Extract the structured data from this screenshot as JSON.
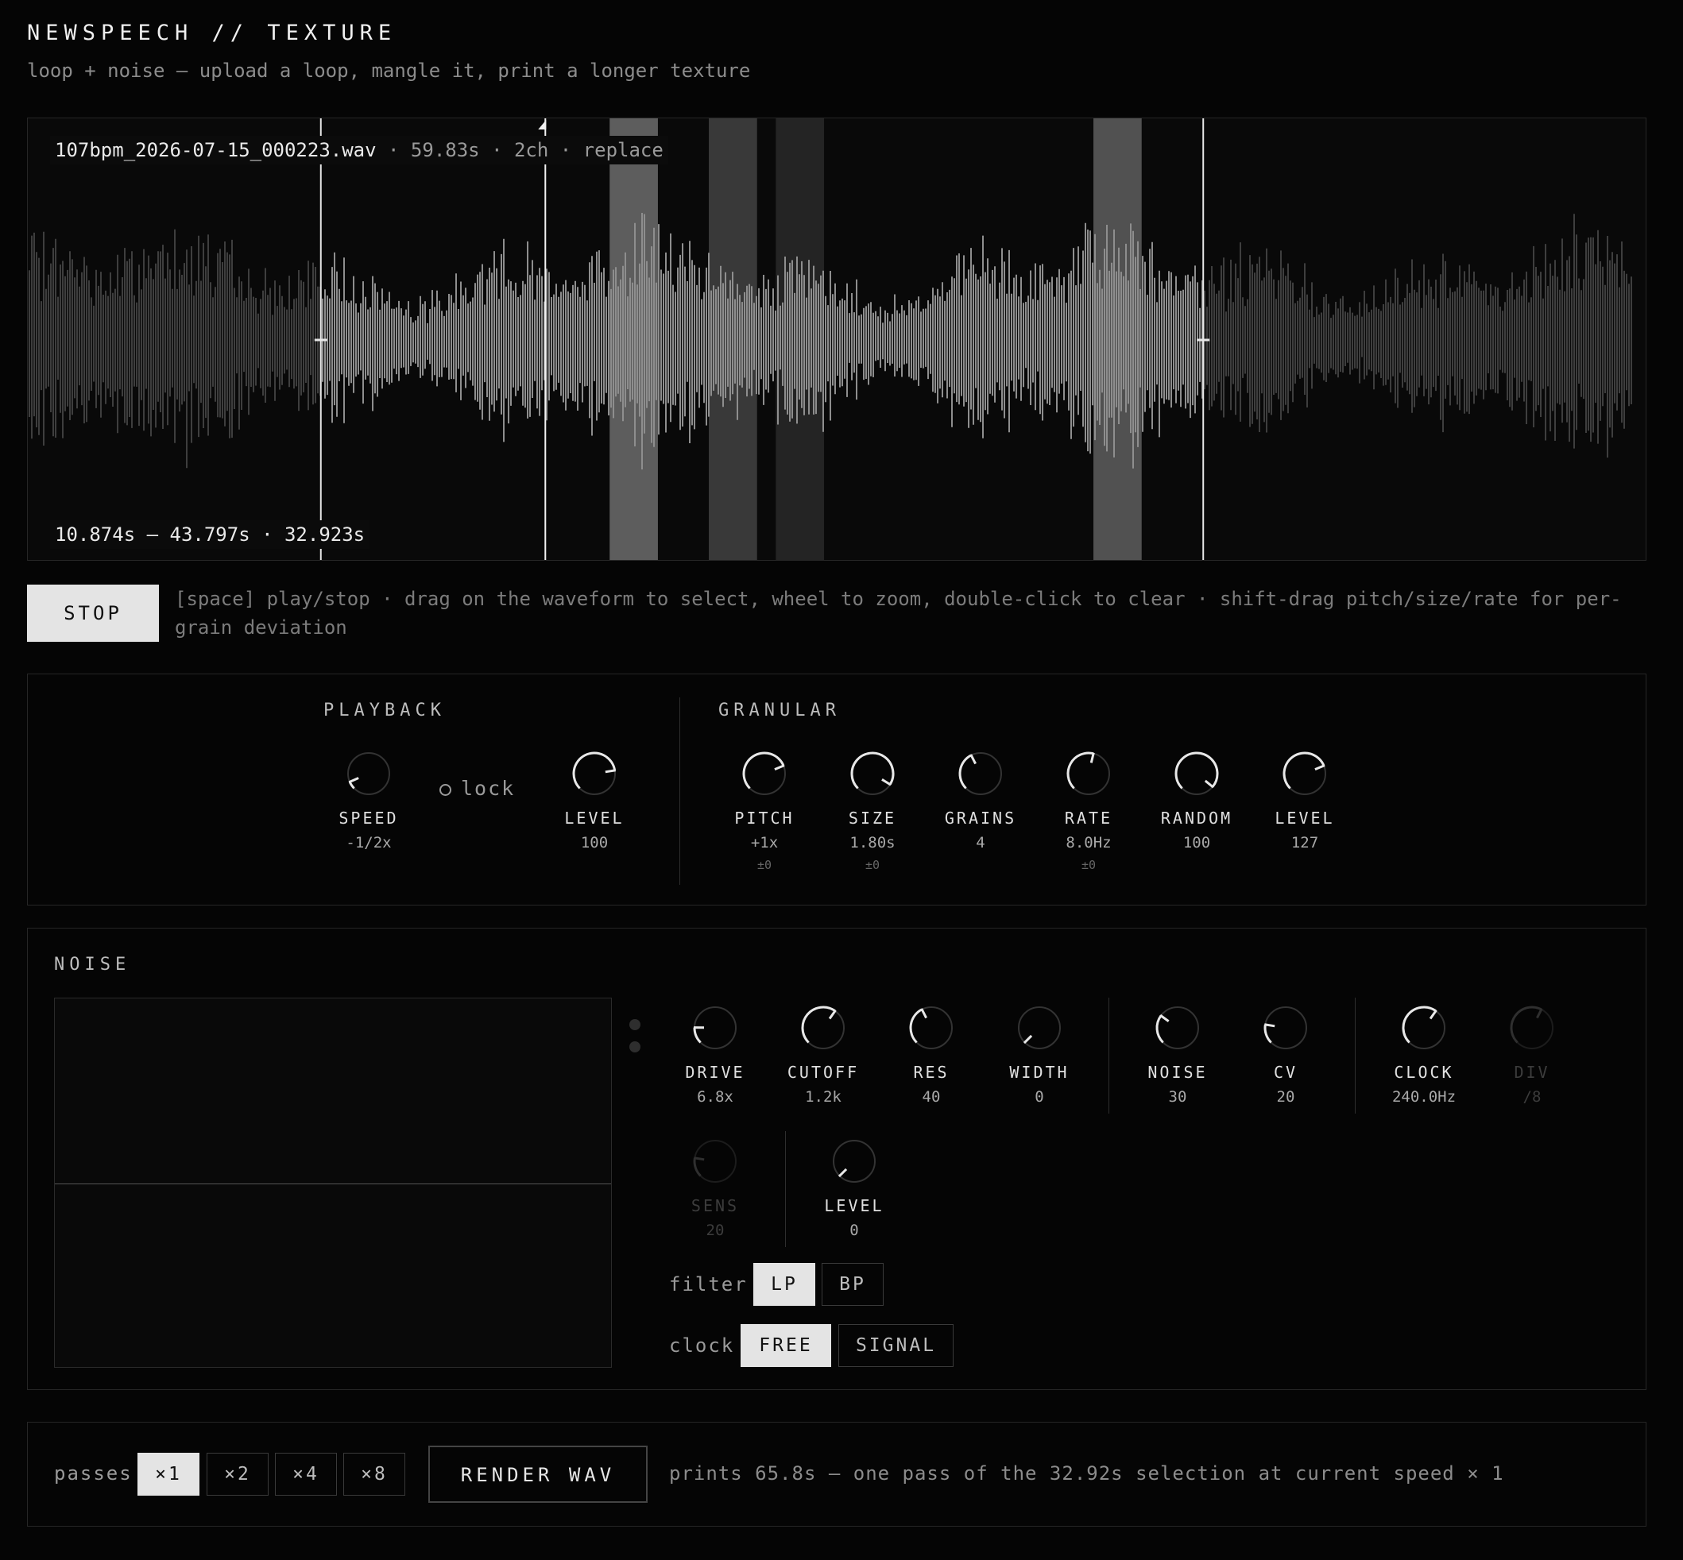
{
  "header": {
    "title": "NEWSPEECH // TEXTURE",
    "subtitle": "loop + noise — upload a loop, mangle it, print a longer texture"
  },
  "waveform": {
    "file_name": "107bpm_2026-07-15_000223.wav",
    "file_meta": "· 59.83s · 2ch ·",
    "replace_label": "replace",
    "selection_readout": "10.874s — 43.797s · 32.923s",
    "duration_s": 59.83,
    "selection_start_s": 10.874,
    "selection_end_s": 43.797,
    "playhead_s": 19.25,
    "grain_windows_s": [
      [
        21.65,
        23.45
      ],
      [
        25.35,
        27.15
      ],
      [
        27.85,
        29.65
      ],
      [
        39.7,
        41.5
      ]
    ]
  },
  "transport": {
    "stop_label": "STOP",
    "hint": "[space] play/stop  ·  drag on the waveform to select, wheel to zoom, double-click to clear  ·  shift-drag pitch/size/rate for per-grain deviation"
  },
  "playback": {
    "title": "PLAYBACK",
    "lock_label": "lock",
    "speed": {
      "label": "SPEED",
      "value": "-1/2x",
      "pos": 0.08
    },
    "level": {
      "label": "LEVEL",
      "value": "100",
      "pos": 0.8
    }
  },
  "granular": {
    "title": "GRANULAR",
    "knobs": [
      {
        "label": "PITCH",
        "value": "+1x",
        "dev": "±0",
        "pos": 0.75
      },
      {
        "label": "SIZE",
        "value": "1.80s",
        "dev": "±0",
        "pos": 0.95
      },
      {
        "label": "GRAINS",
        "value": "4",
        "dev": "",
        "pos": 0.4
      },
      {
        "label": "RATE",
        "value": "8.0Hz",
        "dev": "±0",
        "pos": 0.55
      },
      {
        "label": "RANDOM",
        "value": "100",
        "dev": "",
        "pos": 0.98
      },
      {
        "label": "LEVEL",
        "value": "127",
        "dev": "",
        "pos": 0.75
      }
    ]
  },
  "noise": {
    "title": "NOISE",
    "knobs": [
      {
        "label": "DRIVE",
        "value": "6.8x",
        "pos": 0.17,
        "disabled": false
      },
      {
        "label": "CUTOFF",
        "value": "1.2k",
        "pos": 0.63,
        "disabled": false
      },
      {
        "label": "RES",
        "value": "40",
        "pos": 0.4,
        "disabled": false
      },
      {
        "label": "WIDTH",
        "value": "0",
        "pos": 0.0,
        "disabled": false
      },
      {
        "label": "NOISE",
        "value": "30",
        "pos": 0.3,
        "disabled": false
      },
      {
        "label": "CV",
        "value": "20",
        "pos": 0.2,
        "disabled": false
      },
      {
        "label": "CLOCK",
        "value": "240.0Hz",
        "pos": 0.63,
        "disabled": false
      },
      {
        "label": "DIV",
        "value": "/8",
        "pos": 0.6,
        "disabled": true
      },
      {
        "label": "SENS",
        "value": "20",
        "pos": 0.2,
        "disabled": true
      },
      {
        "label": "LEVEL",
        "value": "0",
        "pos": 0.0,
        "disabled": false
      }
    ],
    "filter_label": "filter",
    "filter_options": [
      "LP",
      "BP"
    ],
    "filter_selected": "LP",
    "clock_label": "clock",
    "clock_options": [
      "FREE",
      "SIGNAL"
    ],
    "clock_selected": "FREE"
  },
  "render": {
    "passes_label": "passes",
    "passes_options": [
      "×1",
      "×2",
      "×4",
      "×8"
    ],
    "passes_selected": "×1",
    "render_label": "RENDER WAV",
    "info": "prints 65.8s — one pass of the 32.92s selection at current speed × 1"
  },
  "colors": {
    "background": "#050505",
    "panel_border": "#262626",
    "accent_light": "#e4e4e4",
    "muted_text": "#7c7c7c"
  }
}
